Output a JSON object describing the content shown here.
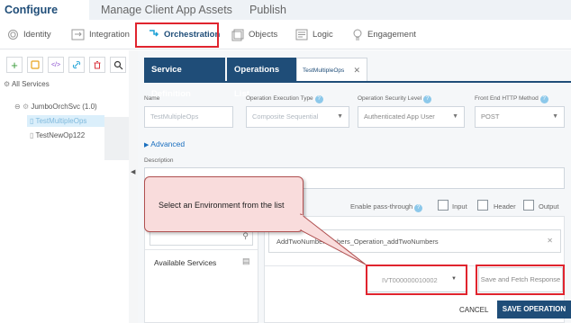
{
  "top_tabs": [
    {
      "label": "Configure Services"
    },
    {
      "label": "Manage Client App Assets"
    },
    {
      "label": "Publish"
    }
  ],
  "subnav": [
    {
      "label": "Identity",
      "icon": "fingerprint-icon"
    },
    {
      "label": "Integration",
      "icon": "integration-icon"
    },
    {
      "label": "Orchestration",
      "icon": "orchestration-icon"
    },
    {
      "label": "Objects",
      "icon": "objects-icon"
    },
    {
      "label": "Logic",
      "icon": "logic-icon"
    },
    {
      "label": "Engagement",
      "icon": "engagement-icon"
    }
  ],
  "left_panel": {
    "root": "All Services",
    "service": "JumboOrchSvc (1.0)",
    "operations": [
      "TestMultipleOps",
      "TestNewOp122"
    ]
  },
  "main_tabs": {
    "service_definition": "Service Definition",
    "operations_list": "Operations List",
    "chip": "TestMultipleOps"
  },
  "form": {
    "name_label": "Name",
    "name_value": "TestMultipleOps",
    "exec_type_label": "Operation Execution Type",
    "exec_type_value": "Composite Sequential",
    "security_label": "Operation Security Level",
    "security_value": "Authenticated App User",
    "http_label": "Front End HTTP Method",
    "http_value": "POST",
    "advanced": "Advanced",
    "description_label": "Description"
  },
  "tooltip": "Select an Environment from the list",
  "passthrough": {
    "label": "Enable pass-through",
    "input": "Input",
    "header": "Header",
    "output": "Output"
  },
  "services_panel": {
    "available_services": "Available Services",
    "operation_field": "AddTwoNumbeNumbers_Operation_addTwoNumbers"
  },
  "environment": {
    "value": "IVT000000010002"
  },
  "buttons": {
    "fetch": "Save and Fetch Response",
    "cancel": "CANCEL",
    "save": "SAVE OPERATION"
  },
  "colors": {
    "brand": "#1f4d78",
    "highlight": "#e0242e",
    "tooltip_bg": "#f9dcdc"
  }
}
